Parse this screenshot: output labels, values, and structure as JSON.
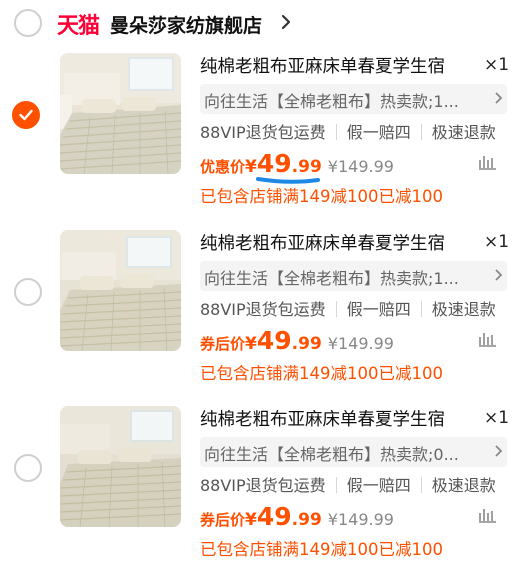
{
  "store": {
    "logo": "天猫",
    "name": "曼朵莎家纺旗舰店"
  },
  "items": [
    {
      "checked": true,
      "title": "纯棉老粗布亚麻床单春夏学生宿",
      "qty": "×1",
      "sku": "向往生活【全棉老粗布】热卖款;1...",
      "perks": [
        "88VIP退货包运费",
        "假一赔四",
        "极速退款"
      ],
      "price_label": "优惠价",
      "yen": "¥",
      "price_int": "49",
      "price_dec": ".99",
      "orig_price": "¥149.99",
      "promo": "已包含店铺满149减100已减100"
    },
    {
      "checked": false,
      "title": "纯棉老粗布亚麻床单春夏学生宿",
      "qty": "×1",
      "sku": "向往生活【全棉老粗布】热卖款;1...",
      "perks": [
        "88VIP退货包运费",
        "假一赔四",
        "极速退款"
      ],
      "price_label": "券后价",
      "yen": "¥",
      "price_int": "49",
      "price_dec": ".99",
      "orig_price": "¥149.99",
      "promo": "已包含店铺满149减100已减100"
    },
    {
      "checked": false,
      "title": "纯棉老粗布亚麻床单春夏学生宿",
      "qty": "×1",
      "sku": "向往生活【全棉老粗布】热卖款;0...",
      "perks": [
        "88VIP退货包运费",
        "假一赔四",
        "极速退款"
      ],
      "price_label": "券后价",
      "yen": "¥",
      "price_int": "49",
      "price_dec": ".99",
      "orig_price": "¥149.99",
      "promo": "已包含店铺满149减100已减100"
    }
  ],
  "colors": {
    "accent": "#ff5000",
    "tmall_red": "#ff0036",
    "annotation_blue": "#1e88e5"
  },
  "icons": [
    "radio-unchecked-icon",
    "radio-checked-icon",
    "chevron-right-icon",
    "chevron-down-icon",
    "find-similar-icon"
  ]
}
